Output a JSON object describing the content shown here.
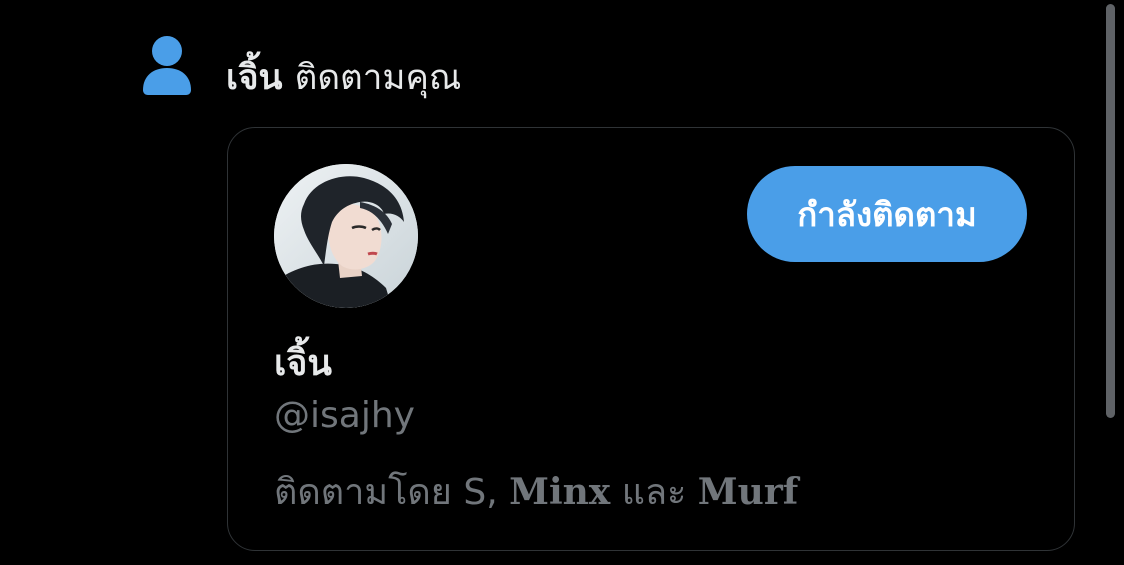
{
  "notification": {
    "icon": "person-icon",
    "icon_color": "#4a9ee8",
    "name": "เจิ้น",
    "action": "ติดตามคุณ"
  },
  "user_card": {
    "avatar": "user-avatar-photo",
    "display_name": "เจิ้น",
    "handle": "@isajhy",
    "follow_button_label": "กำลังติดตาม",
    "follow_button_color": "#4a9ee8",
    "followed_by_prefix": "ติดตามโดย",
    "followed_by_names": [
      "S",
      "Minx",
      "Murf"
    ],
    "followed_by_separator": ",",
    "followed_by_conjunction": "และ"
  }
}
